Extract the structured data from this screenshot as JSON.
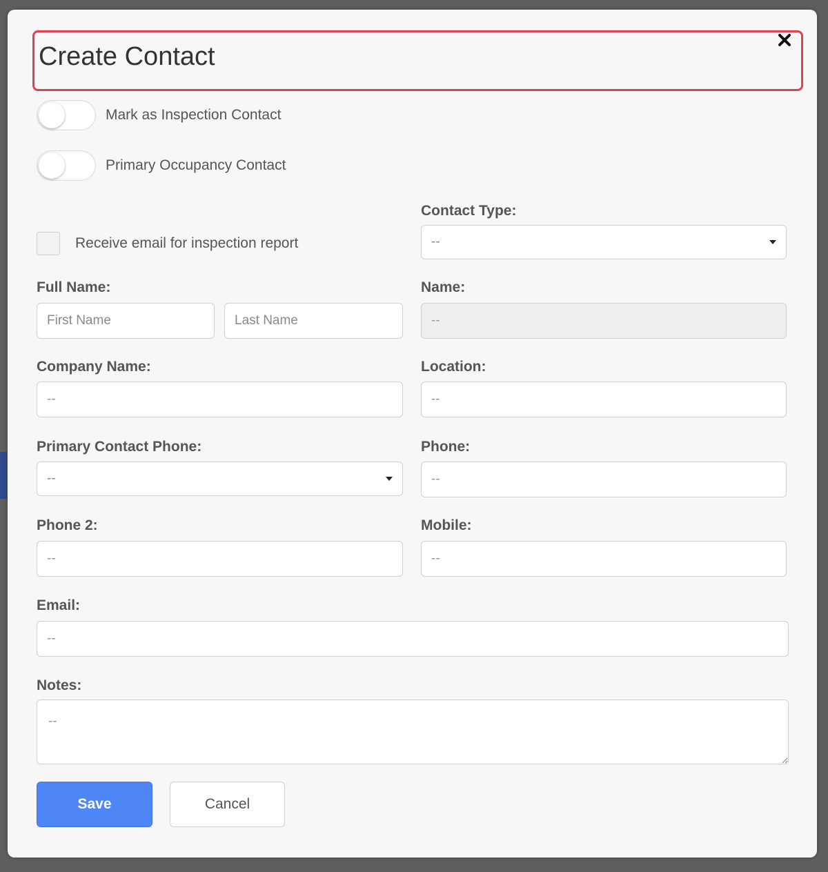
{
  "dialog": {
    "title": "Create Contact",
    "close_icon": "close-icon"
  },
  "toggles": [
    {
      "label": "Mark as Inspection Contact",
      "on": false
    },
    {
      "label": "Primary Occupancy Contact",
      "on": false
    }
  ],
  "checkbox": {
    "label": "Receive email for inspection report",
    "checked": false
  },
  "fields": {
    "contact_type": {
      "label": "Contact Type:",
      "value": "--"
    },
    "full_name": {
      "label": "Full Name:",
      "first_placeholder": "First Name",
      "last_placeholder": "Last Name"
    },
    "name": {
      "label": "Name:",
      "placeholder": "--"
    },
    "company_name": {
      "label": "Company Name:",
      "placeholder": "--"
    },
    "location": {
      "label": "Location:",
      "placeholder": "--"
    },
    "primary_contact_phone": {
      "label": "Primary Contact Phone:",
      "value": "--"
    },
    "phone": {
      "label": "Phone:",
      "placeholder": "--"
    },
    "phone2": {
      "label": "Phone 2:",
      "placeholder": "--"
    },
    "mobile": {
      "label": "Mobile:",
      "placeholder": "--"
    },
    "email": {
      "label": "Email:",
      "placeholder": "--"
    },
    "notes": {
      "label": "Notes:",
      "placeholder": "--"
    }
  },
  "actions": {
    "save_label": "Save",
    "cancel_label": "Cancel"
  },
  "colors": {
    "accent": "#4f86f7",
    "highlight": "#e0404f"
  }
}
